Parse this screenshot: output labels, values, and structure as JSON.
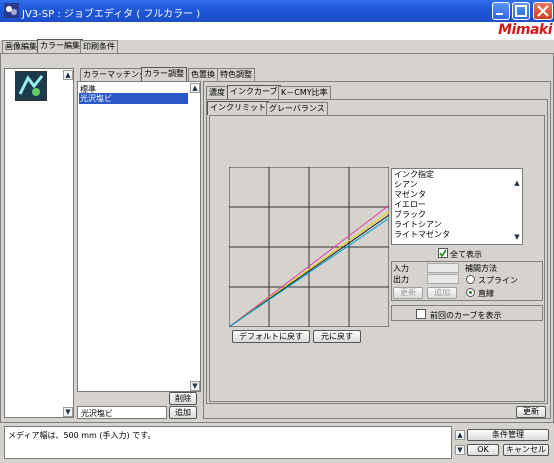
{
  "window": {
    "title": "JV3-SP : ジョブエディタ ( フルカラー )",
    "brand": "Mimaki"
  },
  "main_tabs": [
    "画像編集",
    "カラー編集",
    "印刷条件"
  ],
  "sub_tabs": [
    "カラーマッチング",
    "カラー調整",
    "色置換",
    "特色調整"
  ],
  "inner_tabs": [
    "濃度",
    "インクカーブ",
    "K－CMY比率"
  ],
  "inner_sub_tabs": [
    "インクリミット",
    "グレーバランス"
  ],
  "media_list": {
    "items": [
      "標準",
      "光沢塩ビ"
    ],
    "selected": "光沢塩ビ",
    "delete_label": "削除",
    "add_label": "追加",
    "name_value": "光沢塩ビ"
  },
  "ink_spec": {
    "header": "インク指定",
    "items": [
      "シアン",
      "マゼンタ",
      "イエロー",
      "ブラック",
      "ライトシアン",
      "ライトマゼンタ"
    ],
    "show_all_label": "全て表示",
    "show_all_checked": true
  },
  "io": {
    "input_label": "入力",
    "output_label": "出力",
    "update_label": "更新",
    "add_label": "追加"
  },
  "interp": {
    "header": "補間方法",
    "options": [
      "スプライン",
      "直線"
    ],
    "selected": "直線"
  },
  "prev_curve_label": "前回のカーブを表示",
  "buttons": {
    "reset_default": "デフォルトに戻す",
    "restore": "元に戻す",
    "update": "更新"
  },
  "status": {
    "message": "メディア幅は、500 mm (手入力) です。",
    "conditions": "条件管理",
    "ok": "OK",
    "cancel": "キャンセル"
  },
  "colors": {
    "cyan": "#00a0e0",
    "magenta": "#e040a0",
    "yellow": "#e8d000",
    "black": "#202020",
    "light_cyan": "#80d0f0",
    "light_magenta": "#f0a0d0"
  },
  "chart_data": {
    "type": "line",
    "title": "",
    "xlabel": "",
    "ylabel": "",
    "xlim": [
      0,
      100
    ],
    "ylim": [
      0,
      100
    ],
    "grid": true,
    "series": [
      {
        "color": "#e040a0",
        "x": [
          0,
          100
        ],
        "y": [
          0,
          76
        ]
      },
      {
        "color": "#e8d000",
        "x": [
          0,
          100
        ],
        "y": [
          0,
          72
        ]
      },
      {
        "color": "#202020",
        "x": [
          0,
          100
        ],
        "y": [
          0,
          70
        ]
      },
      {
        "color": "#00a0e0",
        "x": [
          0,
          100
        ],
        "y": [
          0,
          68
        ]
      }
    ]
  }
}
